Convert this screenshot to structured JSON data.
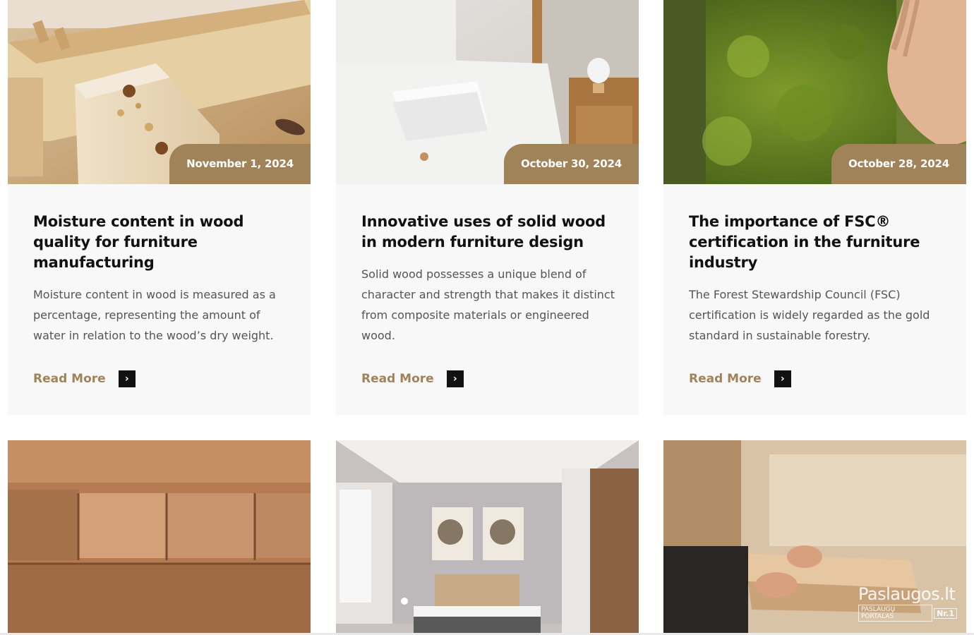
{
  "posts": [
    {
      "date": "November 1, 2024",
      "title": "Moisture content in wood quality for furniture manufacturing",
      "excerpt": "Moisture content in wood is measured as a percentage, representing the amount of water in relation to the wood’s dry weight.",
      "read_more": "Read More"
    },
    {
      "date": "October 30, 2024",
      "title": "Innovative uses of solid wood in modern furniture design",
      "excerpt": "Solid wood possesses a unique blend of character and strength that makes it distinct from composite materials or engineered wood.",
      "read_more": "Read More"
    },
    {
      "date": "October 28, 2024",
      "title": "The importance of FSC® certification in the furniture industry",
      "excerpt": "The Forest Stewardship Council (FSC) certification is widely regarded as the gold standard in sustainable forestry.",
      "read_more": "Read More"
    }
  ],
  "watermark": {
    "brand": "Paslaugos.lt",
    "tagline": "PASLAUGŲ PORTALAS",
    "rank": "Nr.1"
  },
  "colors": {
    "accent": "#a1835a",
    "card_bg": "#f8f8f8",
    "title": "#111111",
    "text": "#555555"
  },
  "icons": {
    "read_more_arrow": "chevron-right-icon"
  }
}
